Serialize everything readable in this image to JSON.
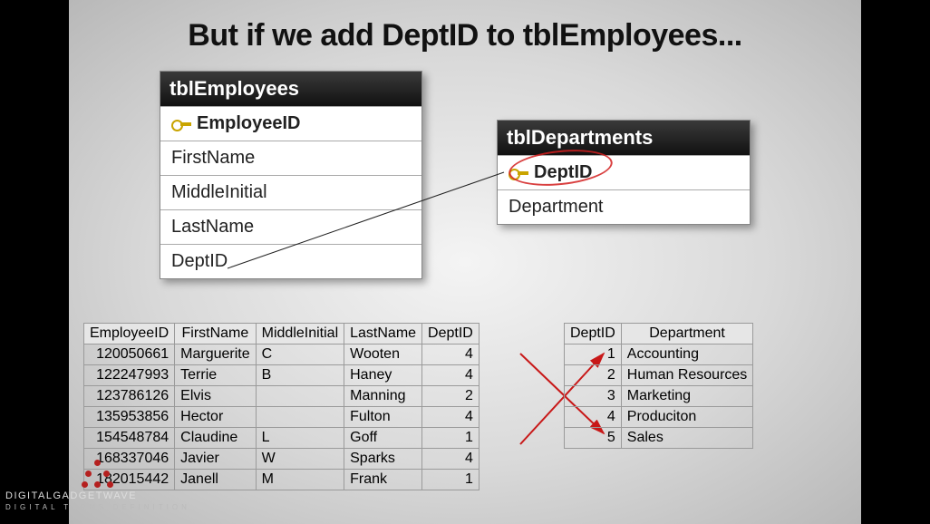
{
  "title": "But if we add DeptID to tblEmployees...",
  "schema_employees": {
    "name": "tblEmployees",
    "fields": [
      {
        "label": "EmployeeID",
        "pk": true
      },
      {
        "label": "FirstName",
        "pk": false
      },
      {
        "label": "MiddleInitial",
        "pk": false
      },
      {
        "label": "LastName",
        "pk": false
      },
      {
        "label": "DeptID",
        "pk": false
      }
    ]
  },
  "schema_departments": {
    "name": "tblDepartments",
    "fields": [
      {
        "label": "DeptID",
        "pk": true
      },
      {
        "label": "Department",
        "pk": false
      }
    ]
  },
  "emp_columns": [
    "EmployeeID",
    "FirstName",
    "MiddleInitial",
    "LastName",
    "DeptID"
  ],
  "emp_rows": [
    {
      "c0": "120050661",
      "c1": "Marguerite",
      "c2": "C",
      "c3": "Wooten",
      "c4": "4"
    },
    {
      "c0": "122247993",
      "c1": "Terrie",
      "c2": "B",
      "c3": "Haney",
      "c4": "4"
    },
    {
      "c0": "123786126",
      "c1": "Elvis",
      "c2": "",
      "c3": "Manning",
      "c4": "2"
    },
    {
      "c0": "135953856",
      "c1": "Hector",
      "c2": "",
      "c3": "Fulton",
      "c4": "4"
    },
    {
      "c0": "154548784",
      "c1": "Claudine",
      "c2": "L",
      "c3": "Goff",
      "c4": "1"
    },
    {
      "c0": "168337046",
      "c1": "Javier",
      "c2": "W",
      "c3": "Sparks",
      "c4": "4"
    },
    {
      "c0": "182015442",
      "c1": "Janell",
      "c2": "M",
      "c3": "Frank",
      "c4": "1"
    }
  ],
  "dep_columns": [
    "DeptID",
    "Department"
  ],
  "dep_rows": [
    {
      "c0": "1",
      "c1": "Accounting"
    },
    {
      "c0": "2",
      "c1": "Human Resources"
    },
    {
      "c0": "3",
      "c1": "Marketing"
    },
    {
      "c0": "4",
      "c1": "Produciton"
    },
    {
      "c0": "5",
      "c1": "Sales"
    }
  ],
  "logo": {
    "main": "DIGITALGADGETWAVE",
    "sub": "DIGITAL TERMS DEFINITION"
  }
}
